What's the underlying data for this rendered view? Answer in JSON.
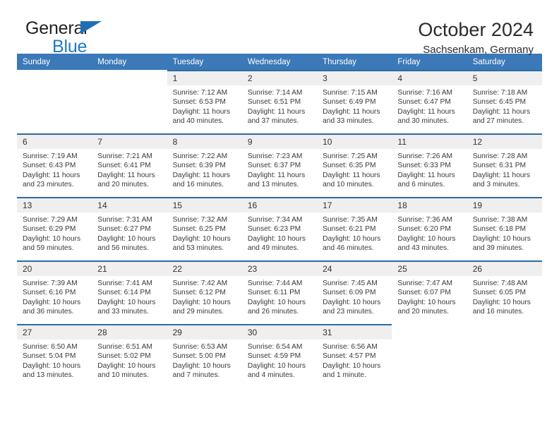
{
  "brand": {
    "name_part1": "General",
    "name_part2": "Blue",
    "triangle_color": "#1f6fb5"
  },
  "header": {
    "title": "October 2024",
    "location": "Sachsenkam, Germany"
  },
  "theme": {
    "header_row_color": "#3b79b8",
    "week_separator_color": "#2b6ca3",
    "daynum_strip_color": "#efefef",
    "text_color": "#3a3a3a"
  },
  "weekday_headers": [
    "Sunday",
    "Monday",
    "Tuesday",
    "Wednesday",
    "Thursday",
    "Friday",
    "Saturday"
  ],
  "weeks": [
    [
      {
        "day": "",
        "sunrise": "",
        "sunset": "",
        "daylight_line1": "",
        "daylight_line2": "",
        "empty": true
      },
      {
        "day": "",
        "sunrise": "",
        "sunset": "",
        "daylight_line1": "",
        "daylight_line2": "",
        "empty": true
      },
      {
        "day": "1",
        "sunrise": "Sunrise: 7:12 AM",
        "sunset": "Sunset: 6:53 PM",
        "daylight_line1": "Daylight: 11 hours",
        "daylight_line2": "and 40 minutes."
      },
      {
        "day": "2",
        "sunrise": "Sunrise: 7:14 AM",
        "sunset": "Sunset: 6:51 PM",
        "daylight_line1": "Daylight: 11 hours",
        "daylight_line2": "and 37 minutes."
      },
      {
        "day": "3",
        "sunrise": "Sunrise: 7:15 AM",
        "sunset": "Sunset: 6:49 PM",
        "daylight_line1": "Daylight: 11 hours",
        "daylight_line2": "and 33 minutes."
      },
      {
        "day": "4",
        "sunrise": "Sunrise: 7:16 AM",
        "sunset": "Sunset: 6:47 PM",
        "daylight_line1": "Daylight: 11 hours",
        "daylight_line2": "and 30 minutes."
      },
      {
        "day": "5",
        "sunrise": "Sunrise: 7:18 AM",
        "sunset": "Sunset: 6:45 PM",
        "daylight_line1": "Daylight: 11 hours",
        "daylight_line2": "and 27 minutes."
      }
    ],
    [
      {
        "day": "6",
        "sunrise": "Sunrise: 7:19 AM",
        "sunset": "Sunset: 6:43 PM",
        "daylight_line1": "Daylight: 11 hours",
        "daylight_line2": "and 23 minutes."
      },
      {
        "day": "7",
        "sunrise": "Sunrise: 7:21 AM",
        "sunset": "Sunset: 6:41 PM",
        "daylight_line1": "Daylight: 11 hours",
        "daylight_line2": "and 20 minutes."
      },
      {
        "day": "8",
        "sunrise": "Sunrise: 7:22 AM",
        "sunset": "Sunset: 6:39 PM",
        "daylight_line1": "Daylight: 11 hours",
        "daylight_line2": "and 16 minutes."
      },
      {
        "day": "9",
        "sunrise": "Sunrise: 7:23 AM",
        "sunset": "Sunset: 6:37 PM",
        "daylight_line1": "Daylight: 11 hours",
        "daylight_line2": "and 13 minutes."
      },
      {
        "day": "10",
        "sunrise": "Sunrise: 7:25 AM",
        "sunset": "Sunset: 6:35 PM",
        "daylight_line1": "Daylight: 11 hours",
        "daylight_line2": "and 10 minutes."
      },
      {
        "day": "11",
        "sunrise": "Sunrise: 7:26 AM",
        "sunset": "Sunset: 6:33 PM",
        "daylight_line1": "Daylight: 11 hours",
        "daylight_line2": "and 6 minutes."
      },
      {
        "day": "12",
        "sunrise": "Sunrise: 7:28 AM",
        "sunset": "Sunset: 6:31 PM",
        "daylight_line1": "Daylight: 11 hours",
        "daylight_line2": "and 3 minutes."
      }
    ],
    [
      {
        "day": "13",
        "sunrise": "Sunrise: 7:29 AM",
        "sunset": "Sunset: 6:29 PM",
        "daylight_line1": "Daylight: 10 hours",
        "daylight_line2": "and 59 minutes."
      },
      {
        "day": "14",
        "sunrise": "Sunrise: 7:31 AM",
        "sunset": "Sunset: 6:27 PM",
        "daylight_line1": "Daylight: 10 hours",
        "daylight_line2": "and 56 minutes."
      },
      {
        "day": "15",
        "sunrise": "Sunrise: 7:32 AM",
        "sunset": "Sunset: 6:25 PM",
        "daylight_line1": "Daylight: 10 hours",
        "daylight_line2": "and 53 minutes."
      },
      {
        "day": "16",
        "sunrise": "Sunrise: 7:34 AM",
        "sunset": "Sunset: 6:23 PM",
        "daylight_line1": "Daylight: 10 hours",
        "daylight_line2": "and 49 minutes."
      },
      {
        "day": "17",
        "sunrise": "Sunrise: 7:35 AM",
        "sunset": "Sunset: 6:21 PM",
        "daylight_line1": "Daylight: 10 hours",
        "daylight_line2": "and 46 minutes."
      },
      {
        "day": "18",
        "sunrise": "Sunrise: 7:36 AM",
        "sunset": "Sunset: 6:20 PM",
        "daylight_line1": "Daylight: 10 hours",
        "daylight_line2": "and 43 minutes."
      },
      {
        "day": "19",
        "sunrise": "Sunrise: 7:38 AM",
        "sunset": "Sunset: 6:18 PM",
        "daylight_line1": "Daylight: 10 hours",
        "daylight_line2": "and 39 minutes."
      }
    ],
    [
      {
        "day": "20",
        "sunrise": "Sunrise: 7:39 AM",
        "sunset": "Sunset: 6:16 PM",
        "daylight_line1": "Daylight: 10 hours",
        "daylight_line2": "and 36 minutes."
      },
      {
        "day": "21",
        "sunrise": "Sunrise: 7:41 AM",
        "sunset": "Sunset: 6:14 PM",
        "daylight_line1": "Daylight: 10 hours",
        "daylight_line2": "and 33 minutes."
      },
      {
        "day": "22",
        "sunrise": "Sunrise: 7:42 AM",
        "sunset": "Sunset: 6:12 PM",
        "daylight_line1": "Daylight: 10 hours",
        "daylight_line2": "and 29 minutes."
      },
      {
        "day": "23",
        "sunrise": "Sunrise: 7:44 AM",
        "sunset": "Sunset: 6:11 PM",
        "daylight_line1": "Daylight: 10 hours",
        "daylight_line2": "and 26 minutes."
      },
      {
        "day": "24",
        "sunrise": "Sunrise: 7:45 AM",
        "sunset": "Sunset: 6:09 PM",
        "daylight_line1": "Daylight: 10 hours",
        "daylight_line2": "and 23 minutes."
      },
      {
        "day": "25",
        "sunrise": "Sunrise: 7:47 AM",
        "sunset": "Sunset: 6:07 PM",
        "daylight_line1": "Daylight: 10 hours",
        "daylight_line2": "and 20 minutes."
      },
      {
        "day": "26",
        "sunrise": "Sunrise: 7:48 AM",
        "sunset": "Sunset: 6:05 PM",
        "daylight_line1": "Daylight: 10 hours",
        "daylight_line2": "and 16 minutes."
      }
    ],
    [
      {
        "day": "27",
        "sunrise": "Sunrise: 6:50 AM",
        "sunset": "Sunset: 5:04 PM",
        "daylight_line1": "Daylight: 10 hours",
        "daylight_line2": "and 13 minutes."
      },
      {
        "day": "28",
        "sunrise": "Sunrise: 6:51 AM",
        "sunset": "Sunset: 5:02 PM",
        "daylight_line1": "Daylight: 10 hours",
        "daylight_line2": "and 10 minutes."
      },
      {
        "day": "29",
        "sunrise": "Sunrise: 6:53 AM",
        "sunset": "Sunset: 5:00 PM",
        "daylight_line1": "Daylight: 10 hours",
        "daylight_line2": "and 7 minutes."
      },
      {
        "day": "30",
        "sunrise": "Sunrise: 6:54 AM",
        "sunset": "Sunset: 4:59 PM",
        "daylight_line1": "Daylight: 10 hours",
        "daylight_line2": "and 4 minutes."
      },
      {
        "day": "31",
        "sunrise": "Sunrise: 6:56 AM",
        "sunset": "Sunset: 4:57 PM",
        "daylight_line1": "Daylight: 10 hours",
        "daylight_line2": "and 1 minute."
      },
      {
        "day": "",
        "sunrise": "",
        "sunset": "",
        "daylight_line1": "",
        "daylight_line2": "",
        "empty": true
      },
      {
        "day": "",
        "sunrise": "",
        "sunset": "",
        "daylight_line1": "",
        "daylight_line2": "",
        "empty": true
      }
    ]
  ]
}
